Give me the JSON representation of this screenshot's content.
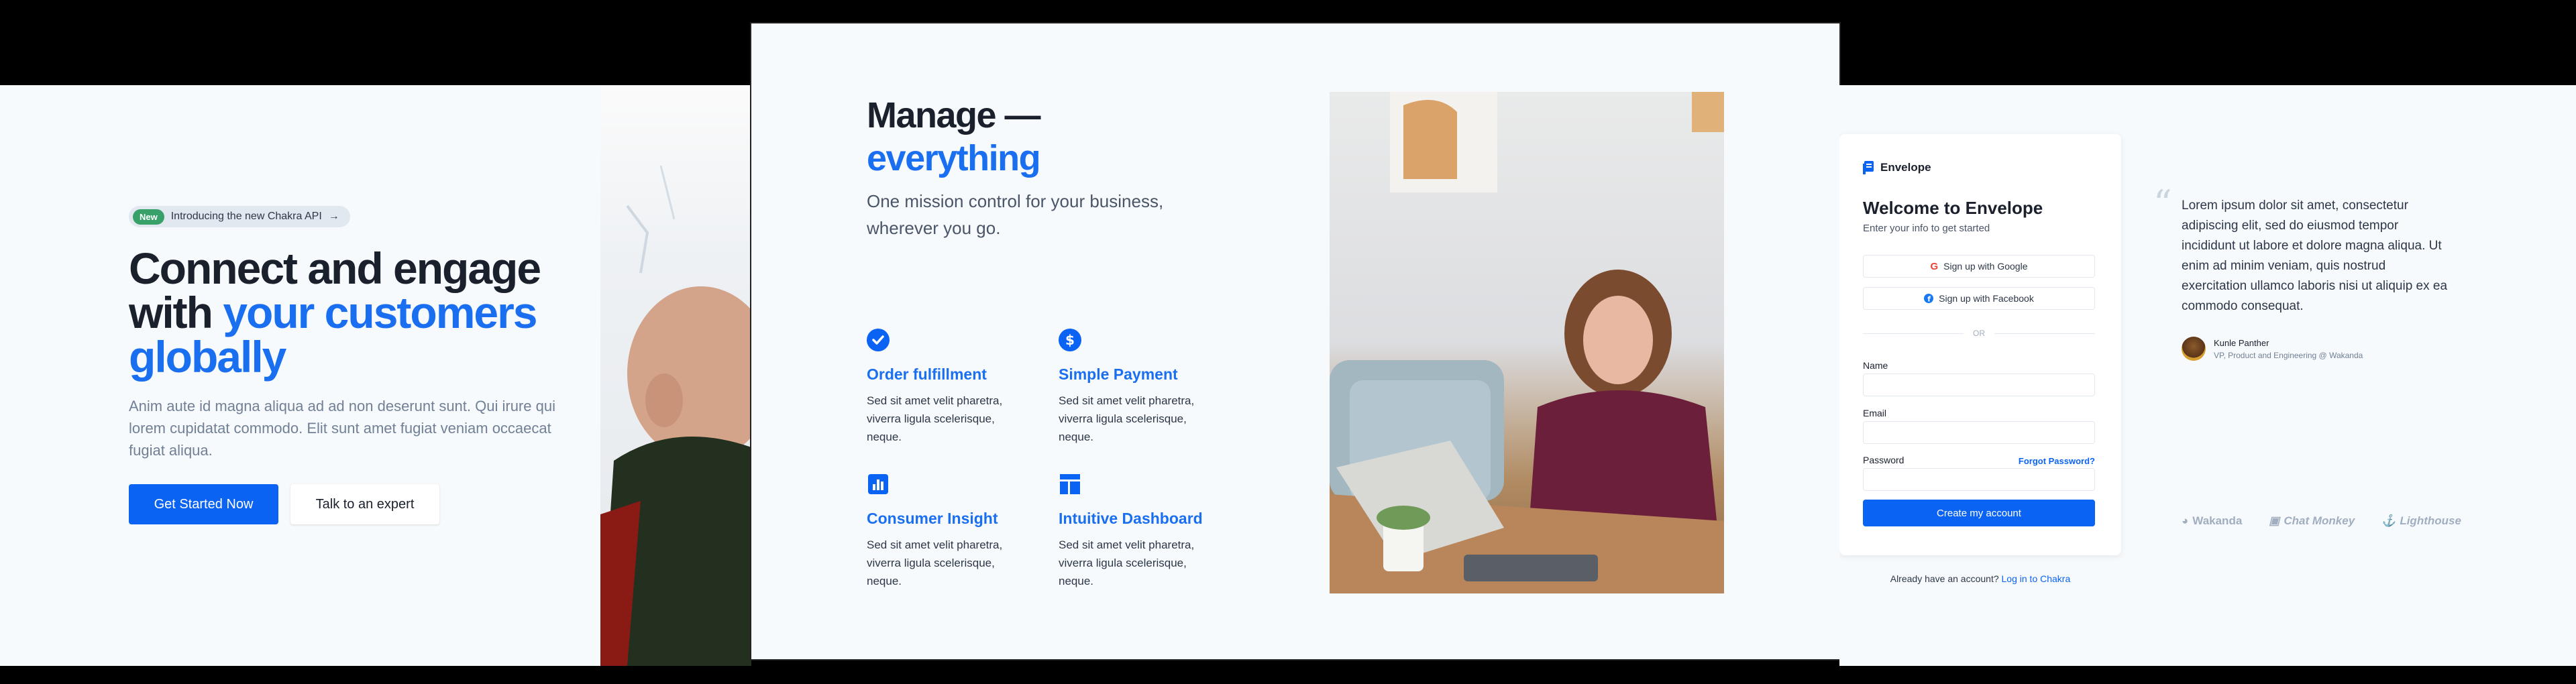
{
  "hero": {
    "badge_tag": "New",
    "badge_text": "Introducing the new Chakra API",
    "heading_part1": "Connect and engage with ",
    "heading_highlight": "your customers globally",
    "description": "Anim aute id magna aliqua ad ad non deserunt sunt. Qui irure qui lorem cupidatat commodo. Elit sunt amet fugiat veniam occaecat fugiat aliqua.",
    "primary_button": "Get Started Now",
    "secondary_button": "Talk to an expert"
  },
  "features": {
    "heading_part1": "Manage —",
    "heading_highlight": "everything",
    "description": "One mission control for your business, wherever you go.",
    "items": [
      {
        "icon": "check-circle-icon",
        "title": "Order fulfillment",
        "description": "Sed sit amet velit pharetra, viverra ligula scelerisque, neque."
      },
      {
        "icon": "dollar-circle-icon",
        "title": "Simple Payment",
        "description": "Sed sit amet velit pharetra, viverra ligula scelerisque, neque."
      },
      {
        "icon": "bar-chart-icon",
        "title": "Consumer Insight",
        "description": "Sed sit amet velit pharetra, viverra ligula scelerisque, neque."
      },
      {
        "icon": "dashboard-icon",
        "title": "Intuitive Dashboard",
        "description": "Sed sit amet velit pharetra, viverra ligula scelerisque, neque."
      }
    ]
  },
  "signup": {
    "brand": "Envelope",
    "title": "Welcome to Envelope",
    "subtitle": "Enter your info to get started",
    "google_button": "Sign up with Google",
    "facebook_button": "Sign up with Facebook",
    "divider": "OR",
    "name_label": "Name",
    "email_label": "Email",
    "password_label": "Password",
    "forgot_link": "Forgot Password?",
    "submit_button": "Create my account",
    "already_text": "Already have an account?",
    "login_link": "Log in to Chakra"
  },
  "testimonial": {
    "quote": "Lorem ipsum dolor sit amet, consectetur adipiscing elit, sed do eiusmod tempor incididunt ut labore et dolore magna aliqua. Ut enim ad minim veniam, quis nostrud exercitation ullamco laboris nisi ut aliquip ex ea commodo consequat.",
    "author_name": "Kunle Panther",
    "author_role": "VP, Product and Engineering @ Wakanda",
    "brands": [
      "Wakanda",
      "Chat Monkey",
      "Lighthouse"
    ]
  },
  "colors": {
    "accent": "#0b63f3",
    "highlight": "#1a6ff0",
    "badge_green": "#38a169"
  }
}
